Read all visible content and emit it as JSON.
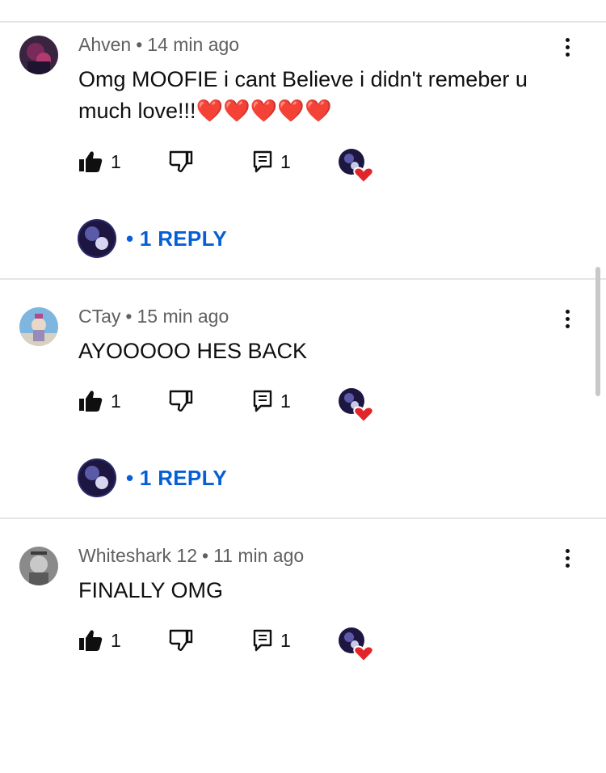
{
  "comments": [
    {
      "author": "Ahven",
      "separator": "•",
      "time": "14 min ago",
      "text": "Omg MOOFIE i cant Believe i didn't remeber u much love!!!❤️❤️❤️❤️❤️",
      "likes": "1",
      "replies_count": "1",
      "reply_link": "• 1 REPLY"
    },
    {
      "author": "CTay",
      "separator": "•",
      "time": "15 min ago",
      "text": "AYOOOOO HES BACK",
      "likes": "1",
      "replies_count": "1",
      "reply_link": "• 1 REPLY"
    },
    {
      "author": "Whiteshark 12",
      "separator": "•",
      "time": "11 min ago",
      "text": "FINALLY OMG",
      "likes": "1",
      "replies_count": "1"
    }
  ],
  "colors": {
    "link": "#065fd4",
    "meta_text": "#606060",
    "divider": "#e5e5e5",
    "heart": "#e0262b"
  },
  "icons": [
    "like-icon",
    "dislike-icon",
    "reply-icon",
    "more-vert-icon",
    "creator-heart-icon"
  ]
}
